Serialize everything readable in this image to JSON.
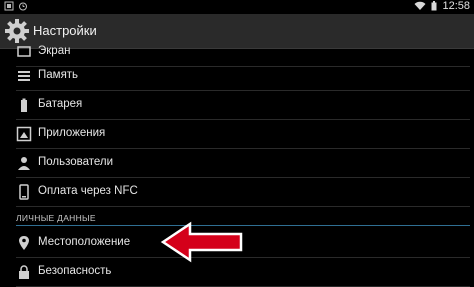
{
  "status_bar": {
    "time": "12:58",
    "left_icons": [
      "screenshot-icon",
      "alarm-icon"
    ],
    "right_icons": [
      "wifi-icon",
      "battery-icon"
    ]
  },
  "action_bar": {
    "title": "Настройки",
    "app_icon": "gear-icon"
  },
  "list": {
    "items": [
      {
        "label": "Экран",
        "icon": "display-icon"
      },
      {
        "label": "Память",
        "icon": "storage-icon"
      },
      {
        "label": "Батарея",
        "icon": "battery-icon"
      },
      {
        "label": "Приложения",
        "icon": "apps-icon"
      },
      {
        "label": "Пользователи",
        "icon": "users-icon"
      },
      {
        "label": "Оплата через NFC",
        "icon": "nfc-payment-icon"
      }
    ],
    "section_personal": "ЛИЧНЫЕ ДАННЫЕ",
    "personal_items": [
      {
        "label": "Местоположение",
        "icon": "location-pin-icon"
      },
      {
        "label": "Безопасность",
        "icon": "lock-icon"
      }
    ]
  },
  "annotation": {
    "arrow_color": "#d4001a",
    "arrow_outline": "#ffffff",
    "points_to": "Местоположение"
  },
  "colors": {
    "background": "#000000",
    "action_bar": "#2a2a2a",
    "section_divider": "#2f6f93"
  }
}
